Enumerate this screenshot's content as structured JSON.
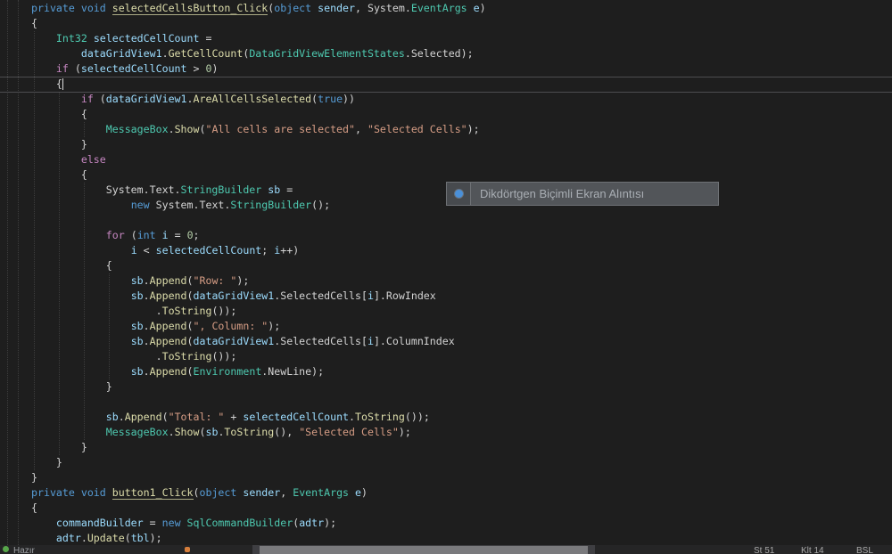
{
  "colors": {
    "editor_bg": "#1e1e1e",
    "keyword": "#569cd6",
    "control_keyword": "#c586c0",
    "type": "#4ec9b0",
    "method": "#dcdcaa",
    "variable": "#9cdcfe",
    "string": "#d69d85",
    "number": "#b5cea8",
    "plain": "#d4d4d4",
    "tooltip_accent": "#4a90d9"
  },
  "code": {
    "lines": [
      [
        [
          "k",
          "private void "
        ],
        [
          "md",
          "selectedCellsButton_Click"
        ],
        [
          "p",
          "("
        ],
        [
          "k",
          "object "
        ],
        [
          "v",
          "sender"
        ],
        [
          "p",
          ", System."
        ],
        [
          "ty",
          "EventArgs"
        ],
        [
          "p",
          " "
        ],
        [
          "v",
          "e"
        ],
        [
          "p",
          ")"
        ]
      ],
      [
        [
          "p",
          "{"
        ]
      ],
      [
        [
          "p",
          "    "
        ],
        [
          "ty",
          "Int32"
        ],
        [
          "p",
          " "
        ],
        [
          "v",
          "selectedCellCount"
        ],
        [
          "p",
          " ="
        ]
      ],
      [
        [
          "p",
          "        "
        ],
        [
          "v",
          "dataGridView1"
        ],
        [
          "p",
          "."
        ],
        [
          "m",
          "GetCellCount"
        ],
        [
          "p",
          "("
        ],
        [
          "ty",
          "DataGridViewElementStates"
        ],
        [
          "p",
          ".Selected);"
        ]
      ],
      [
        [
          "p",
          "    "
        ],
        [
          "cf",
          "if"
        ],
        [
          "p",
          " ("
        ],
        [
          "v",
          "selectedCellCount"
        ],
        [
          "p",
          " > "
        ],
        [
          "n",
          "0"
        ],
        [
          "p",
          ")"
        ]
      ],
      [
        [
          "p",
          "    {"
        ]
      ],
      [
        [
          "p",
          "        "
        ],
        [
          "cf",
          "if"
        ],
        [
          "p",
          " ("
        ],
        [
          "v",
          "dataGridView1"
        ],
        [
          "p",
          "."
        ],
        [
          "m",
          "AreAllCellsSelected"
        ],
        [
          "p",
          "("
        ],
        [
          "k",
          "true"
        ],
        [
          "p",
          "))"
        ]
      ],
      [
        [
          "p",
          "        {"
        ]
      ],
      [
        [
          "p",
          "            "
        ],
        [
          "ty",
          "MessageBox"
        ],
        [
          "p",
          "."
        ],
        [
          "m",
          "Show"
        ],
        [
          "p",
          "("
        ],
        [
          "s",
          "\"All cells are selected\""
        ],
        [
          "p",
          ", "
        ],
        [
          "s",
          "\"Selected Cells\""
        ],
        [
          "p",
          ");"
        ]
      ],
      [
        [
          "p",
          "        }"
        ]
      ],
      [
        [
          "p",
          "        "
        ],
        [
          "cf",
          "else"
        ]
      ],
      [
        [
          "p",
          "        {"
        ]
      ],
      [
        [
          "p",
          "            System.Text."
        ],
        [
          "ty",
          "StringBuilder"
        ],
        [
          "p",
          " "
        ],
        [
          "v",
          "sb"
        ],
        [
          "p",
          " ="
        ]
      ],
      [
        [
          "p",
          "                "
        ],
        [
          "k",
          "new"
        ],
        [
          "p",
          " System.Text."
        ],
        [
          "ty",
          "StringBuilder"
        ],
        [
          "p",
          "();"
        ]
      ],
      [],
      [
        [
          "p",
          "            "
        ],
        [
          "cf",
          "for"
        ],
        [
          "p",
          " ("
        ],
        [
          "k",
          "int"
        ],
        [
          "p",
          " "
        ],
        [
          "v",
          "i"
        ],
        [
          "p",
          " = "
        ],
        [
          "n",
          "0"
        ],
        [
          "p",
          ";"
        ]
      ],
      [
        [
          "p",
          "                "
        ],
        [
          "v",
          "i"
        ],
        [
          "p",
          " < "
        ],
        [
          "v",
          "selectedCellCount"
        ],
        [
          "p",
          "; "
        ],
        [
          "v",
          "i"
        ],
        [
          "p",
          "++)"
        ]
      ],
      [
        [
          "p",
          "            {"
        ]
      ],
      [
        [
          "p",
          "                "
        ],
        [
          "v",
          "sb"
        ],
        [
          "p",
          "."
        ],
        [
          "m",
          "Append"
        ],
        [
          "p",
          "("
        ],
        [
          "s",
          "\"Row: \""
        ],
        [
          "p",
          ");"
        ]
      ],
      [
        [
          "p",
          "                "
        ],
        [
          "v",
          "sb"
        ],
        [
          "p",
          "."
        ],
        [
          "m",
          "Append"
        ],
        [
          "p",
          "("
        ],
        [
          "v",
          "dataGridView1"
        ],
        [
          "p",
          ".SelectedCells["
        ],
        [
          "v",
          "i"
        ],
        [
          "p",
          "].RowIndex"
        ]
      ],
      [
        [
          "p",
          "                    ."
        ],
        [
          "m",
          "ToString"
        ],
        [
          "p",
          "());"
        ]
      ],
      [
        [
          "p",
          "                "
        ],
        [
          "v",
          "sb"
        ],
        [
          "p",
          "."
        ],
        [
          "m",
          "Append"
        ],
        [
          "p",
          "("
        ],
        [
          "s",
          "\", Column: \""
        ],
        [
          "p",
          ");"
        ]
      ],
      [
        [
          "p",
          "                "
        ],
        [
          "v",
          "sb"
        ],
        [
          "p",
          "."
        ],
        [
          "m",
          "Append"
        ],
        [
          "p",
          "("
        ],
        [
          "v",
          "dataGridView1"
        ],
        [
          "p",
          ".SelectedCells["
        ],
        [
          "v",
          "i"
        ],
        [
          "p",
          "].ColumnIndex"
        ]
      ],
      [
        [
          "p",
          "                    ."
        ],
        [
          "m",
          "ToString"
        ],
        [
          "p",
          "());"
        ]
      ],
      [
        [
          "p",
          "                "
        ],
        [
          "v",
          "sb"
        ],
        [
          "p",
          "."
        ],
        [
          "m",
          "Append"
        ],
        [
          "p",
          "("
        ],
        [
          "ty",
          "Environment"
        ],
        [
          "p",
          ".NewLine);"
        ]
      ],
      [
        [
          "p",
          "            }"
        ]
      ],
      [],
      [
        [
          "p",
          "            "
        ],
        [
          "v",
          "sb"
        ],
        [
          "p",
          "."
        ],
        [
          "m",
          "Append"
        ],
        [
          "p",
          "("
        ],
        [
          "s",
          "\"Total: \""
        ],
        [
          "p",
          " + "
        ],
        [
          "v",
          "selectedCellCount"
        ],
        [
          "p",
          "."
        ],
        [
          "m",
          "ToString"
        ],
        [
          "p",
          "());"
        ]
      ],
      [
        [
          "p",
          "            "
        ],
        [
          "ty",
          "MessageBox"
        ],
        [
          "p",
          "."
        ],
        [
          "m",
          "Show"
        ],
        [
          "p",
          "("
        ],
        [
          "v",
          "sb"
        ],
        [
          "p",
          "."
        ],
        [
          "m",
          "ToString"
        ],
        [
          "p",
          "(), "
        ],
        [
          "s",
          "\"Selected Cells\""
        ],
        [
          "p",
          ");"
        ]
      ],
      [
        [
          "p",
          "        }"
        ]
      ],
      [
        [
          "p",
          "    }"
        ]
      ],
      [
        [
          "p",
          "}"
        ]
      ],
      [
        [
          "k",
          "private void "
        ],
        [
          "md",
          "button1_Click"
        ],
        [
          "p",
          "("
        ],
        [
          "k",
          "object "
        ],
        [
          "v",
          "sender"
        ],
        [
          "p",
          ", "
        ],
        [
          "ty",
          "EventArgs"
        ],
        [
          "p",
          " "
        ],
        [
          "v",
          "e"
        ],
        [
          "p",
          ")"
        ]
      ],
      [
        [
          "p",
          "{"
        ]
      ],
      [
        [
          "p",
          "    "
        ],
        [
          "v",
          "commandBuilder"
        ],
        [
          "p",
          " = "
        ],
        [
          "k",
          "new "
        ],
        [
          "ty",
          "SqlCommandBuilder"
        ],
        [
          "p",
          "("
        ],
        [
          "v",
          "adtr"
        ],
        [
          "p",
          ");"
        ]
      ],
      [
        [
          "p",
          "    "
        ],
        [
          "v",
          "adtr"
        ],
        [
          "p",
          "."
        ],
        [
          "m",
          "Update"
        ],
        [
          "p",
          "("
        ],
        [
          "v",
          "tbl"
        ],
        [
          "p",
          ");"
        ]
      ]
    ]
  },
  "overlay": {
    "icon": "snip-mode-blue-dot-icon",
    "label": "Dikdörtgen Biçimli Ekran Alıntısı"
  },
  "status_bar": {
    "left_label": "Hazır",
    "position_info": [
      "St 51",
      "Klt 14",
      "BSL"
    ]
  }
}
